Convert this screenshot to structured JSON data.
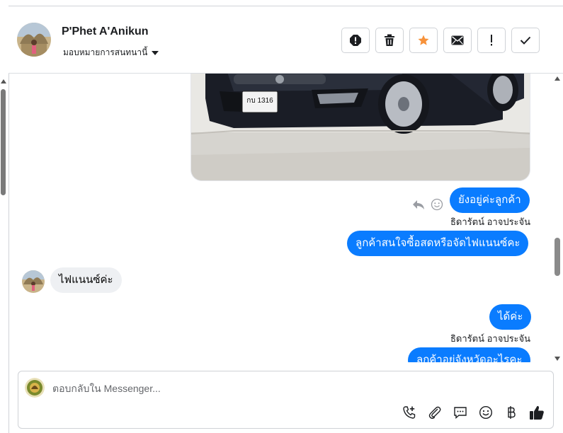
{
  "header": {
    "contact_name": "P'Phet A'Anikun",
    "assign_label": "มอบหมายการสนทนานี้",
    "actions": [
      "spam-icon",
      "trash-icon",
      "star-icon",
      "mark-unread-icon",
      "follow-up-icon",
      "done-icon"
    ],
    "star_color": "#f7923a"
  },
  "messages": {
    "m1": "ยังอยู่ค่ะลูกค้า",
    "m1_sender": "ธิดารัตน์ อาจประจัน",
    "m2": "ลูกค้าสนใจซื้อสดหรือจัดไฟแนนซ์คะ",
    "m3": "ไฟแนนซ์ค่ะ",
    "m4": "ได้ค่ะ",
    "m4_sender": "ธิดารัตน์ อาจประจัน",
    "m5": "ลูกค้าอยู่จังหวัดอะไรคะ",
    "plate_text": "กบ 1316"
  },
  "composer": {
    "placeholder": "ตอบกลับใน Messenger...",
    "tools": [
      "call-add-icon",
      "attach-icon",
      "saved-reply-icon",
      "emoji-icon",
      "baht-icon",
      "like-icon"
    ]
  },
  "colors": {
    "outgoing_bubble": "#0a7cff",
    "incoming_bubble": "#eef0f3"
  }
}
